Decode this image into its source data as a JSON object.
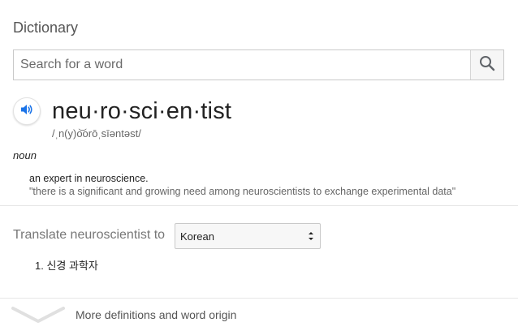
{
  "header": {
    "title": "Dictionary"
  },
  "search": {
    "placeholder": "Search for a word",
    "value": "",
    "button_icon": "search-icon"
  },
  "entry": {
    "speaker_icon": "speaker-icon",
    "word": "neu·ro·sci·en·tist",
    "phonetic": "/ˌn(y)o͝orōˌsīəntəst/",
    "part_of_speech": "noun",
    "definition": "an expert in neuroscience.",
    "example": "\"there is a significant and growing need among neuroscientists to exchange experimental data\""
  },
  "translate": {
    "label": "Translate neuroscientist to",
    "selected_language": "Korean",
    "results": [
      "1. 신경 과학자"
    ]
  },
  "footer": {
    "more_icon": "chevron-down-icon",
    "more_label": "More definitions and word origin"
  },
  "colors": {
    "speaker_blue": "#1a73e8",
    "divider": "#e6e6e6"
  }
}
